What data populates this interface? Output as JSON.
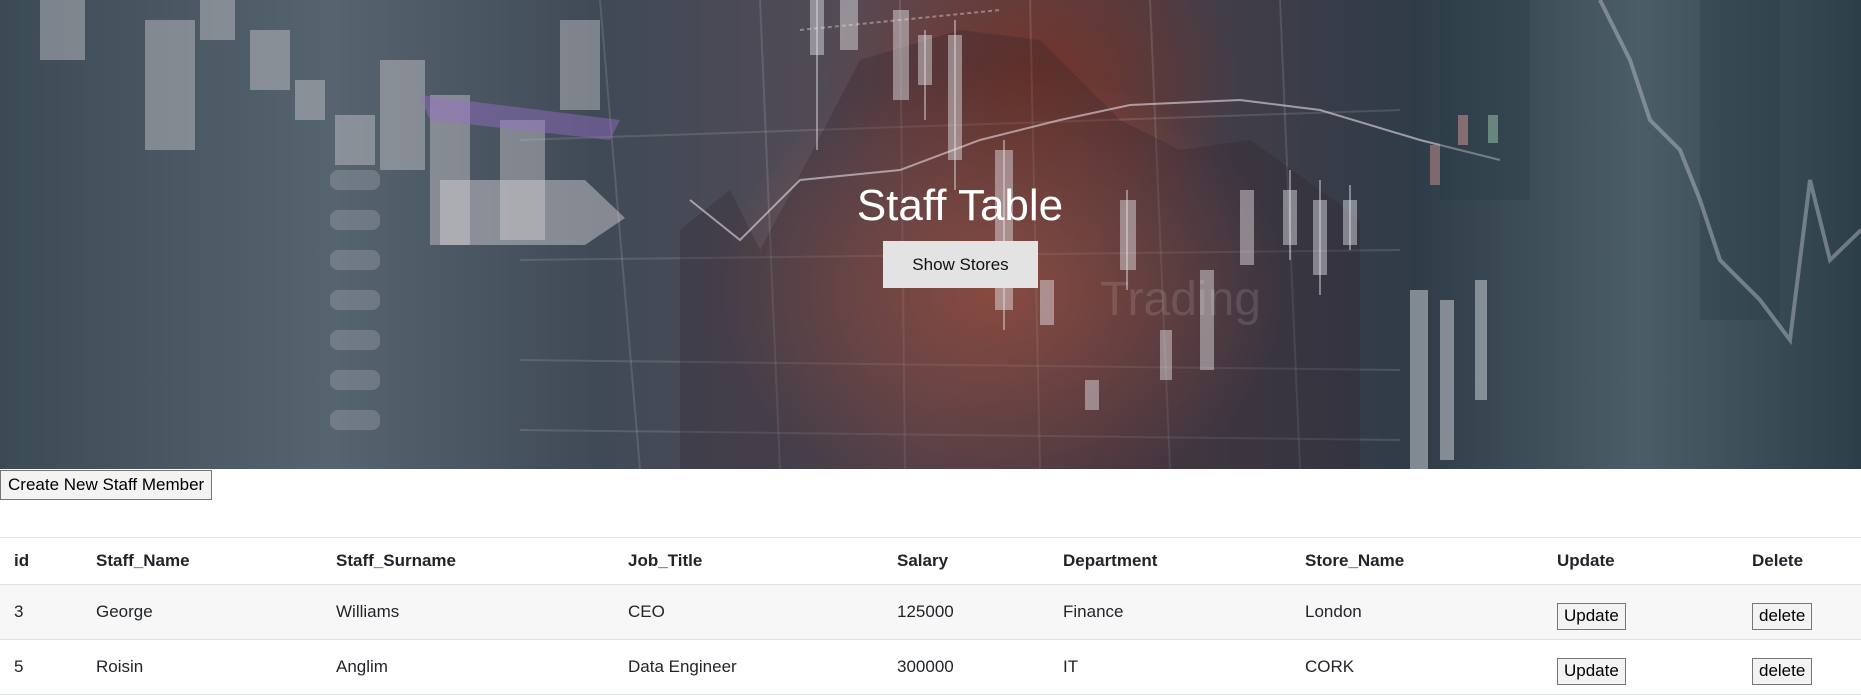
{
  "hero": {
    "title": "Staff Table",
    "show_stores_label": "Show Stores"
  },
  "create_label": "Create New Staff Member",
  "table": {
    "columns": [
      "id",
      "Staff_Name",
      "Staff_Surname",
      "Job_Title",
      "Salary",
      "Department",
      "Store_Name",
      "Update",
      "Delete"
    ],
    "rows": [
      {
        "id": "3",
        "name": "George",
        "surname": "Williams",
        "job": "CEO",
        "salary": "125000",
        "department": "Finance",
        "store": "London",
        "update_label": "Update",
        "delete_label": "delete"
      },
      {
        "id": "5",
        "name": "Roisin",
        "surname": "Anglim",
        "job": "Data Engineer",
        "salary": "300000",
        "department": "IT",
        "store": "CORK",
        "update_label": "Update",
        "delete_label": "delete"
      }
    ]
  }
}
